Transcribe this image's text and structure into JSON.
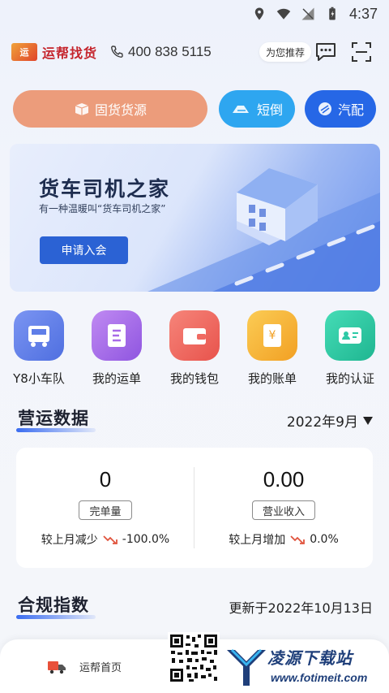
{
  "status_bar": {
    "time": "4:37",
    "icons": [
      "location-icon",
      "wifi-icon",
      "signal-icon",
      "battery-icon"
    ]
  },
  "header": {
    "logo_text": "运",
    "brand_name": "运帮找货",
    "phone_number": "400 838 5115",
    "recommend_label": "为您推荐",
    "icons": [
      "phone-icon",
      "message-icon",
      "scan-icon"
    ]
  },
  "actions": [
    {
      "label": "固货货源",
      "color": "#ec9c7b",
      "icon": "box-icon"
    },
    {
      "label": "短倒",
      "color": "#2ea6f0",
      "icon": "truck-icon"
    },
    {
      "label": "汽配",
      "color": "#2667e6",
      "icon": "parts-icon"
    }
  ],
  "banner": {
    "title": "货车司机之家",
    "subtitle": "有一种温暖叫“货车司机之家”",
    "button_label": "申请入会"
  },
  "quick_menu": [
    {
      "label": "Y8小车队",
      "icon": "fleet-icon",
      "color": "#5f7ee8"
    },
    {
      "label": "我的运单",
      "icon": "waybill-icon",
      "color": "#a86be8"
    },
    {
      "label": "我的钱包",
      "icon": "wallet-icon",
      "color": "#f06a62"
    },
    {
      "label": "我的账单",
      "icon": "bill-icon",
      "color": "#f6b63a"
    },
    {
      "label": "我的认证",
      "icon": "certification-icon",
      "color": "#2ec9a6"
    }
  ],
  "operations": {
    "title": "营运数据",
    "month": "2022年9月",
    "stats": [
      {
        "value": "0",
        "label": "完单量",
        "compare_text": "较上月减少",
        "trend_value": "-100.0%"
      },
      {
        "value": "0.00",
        "label": "营业收入",
        "compare_text": "较上月增加",
        "trend_value": "0.0%"
      }
    ]
  },
  "compliance": {
    "title": "合规指数",
    "updated": "更新于2022年10月13日"
  },
  "bottom_nav": {
    "home_label": "运帮首页"
  },
  "watermark": {
    "title": "凌源下载站",
    "url": "www.fotimeit.com"
  }
}
